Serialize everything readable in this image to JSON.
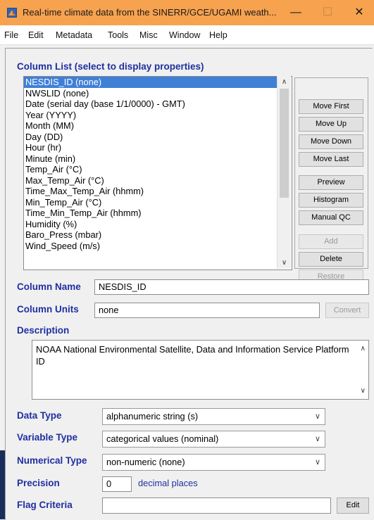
{
  "window": {
    "title": "Real-time climate data from the SINERR/GCE/UGAMI weath...",
    "min_glyph": "—",
    "max_glyph": "☐",
    "close_glyph": "✕",
    "titlebar_color": "#f7a24f",
    "icon_name": "matlab-icon"
  },
  "menu": [
    "File",
    "Edit",
    "Metadata",
    "Tools",
    "Misc",
    "Window",
    "Help"
  ],
  "column_list": {
    "label": "Column List (select to display properties)",
    "items": [
      "NESDIS_ID  (none)",
      "NWSLID  (none)",
      "Date  (serial day (base 1/1/0000) - GMT)",
      "Year  (YYYY)",
      "Month  (MM)",
      "Day  (DD)",
      "Hour  (hr)",
      "Minute  (min)",
      "Temp_Air  (°C)",
      "Max_Temp_Air  (°C)",
      "Time_Max_Temp_Air  (hhmm)",
      "Min_Temp_Air  (°C)",
      "Time_Min_Temp_Air  (hhmm)",
      "Humidity  (%)",
      "Baro_Press  (mbar)",
      "Wind_Speed  (m/s)"
    ],
    "selected_index": 0,
    "selection_color": "#3f7fd6"
  },
  "buttons": {
    "move_first": "Move First",
    "move_up": "Move Up",
    "move_down": "Move Down",
    "move_last": "Move Last",
    "preview": "Preview",
    "histogram": "Histogram",
    "manual_qc": "Manual QC",
    "add": "Add",
    "delete": "Delete",
    "restore": "Restore"
  },
  "column_name": {
    "label": "Column Name",
    "value": "NESDIS_ID"
  },
  "column_units": {
    "label": "Column Units",
    "value": "none",
    "convert": "Convert"
  },
  "description": {
    "label": "Description",
    "text": "NOAA National Environmental Satellite, Data and Information Service Platform ID"
  },
  "data_type": {
    "label": "Data Type",
    "value": "alphanumeric string (s)"
  },
  "variable_type": {
    "label": "Variable Type",
    "value": "categorical values (nominal)"
  },
  "numerical_type": {
    "label": "Numerical Type",
    "value": "non-numeric (none)"
  },
  "precision": {
    "label": "Precision",
    "value": "0",
    "suffix": "decimal places"
  },
  "flag_criteria": {
    "label": "Flag Criteria",
    "value": "",
    "edit": "Edit"
  },
  "colors": {
    "label_blue": "#1f2fa0",
    "accent_orange": "#f7a24f"
  }
}
